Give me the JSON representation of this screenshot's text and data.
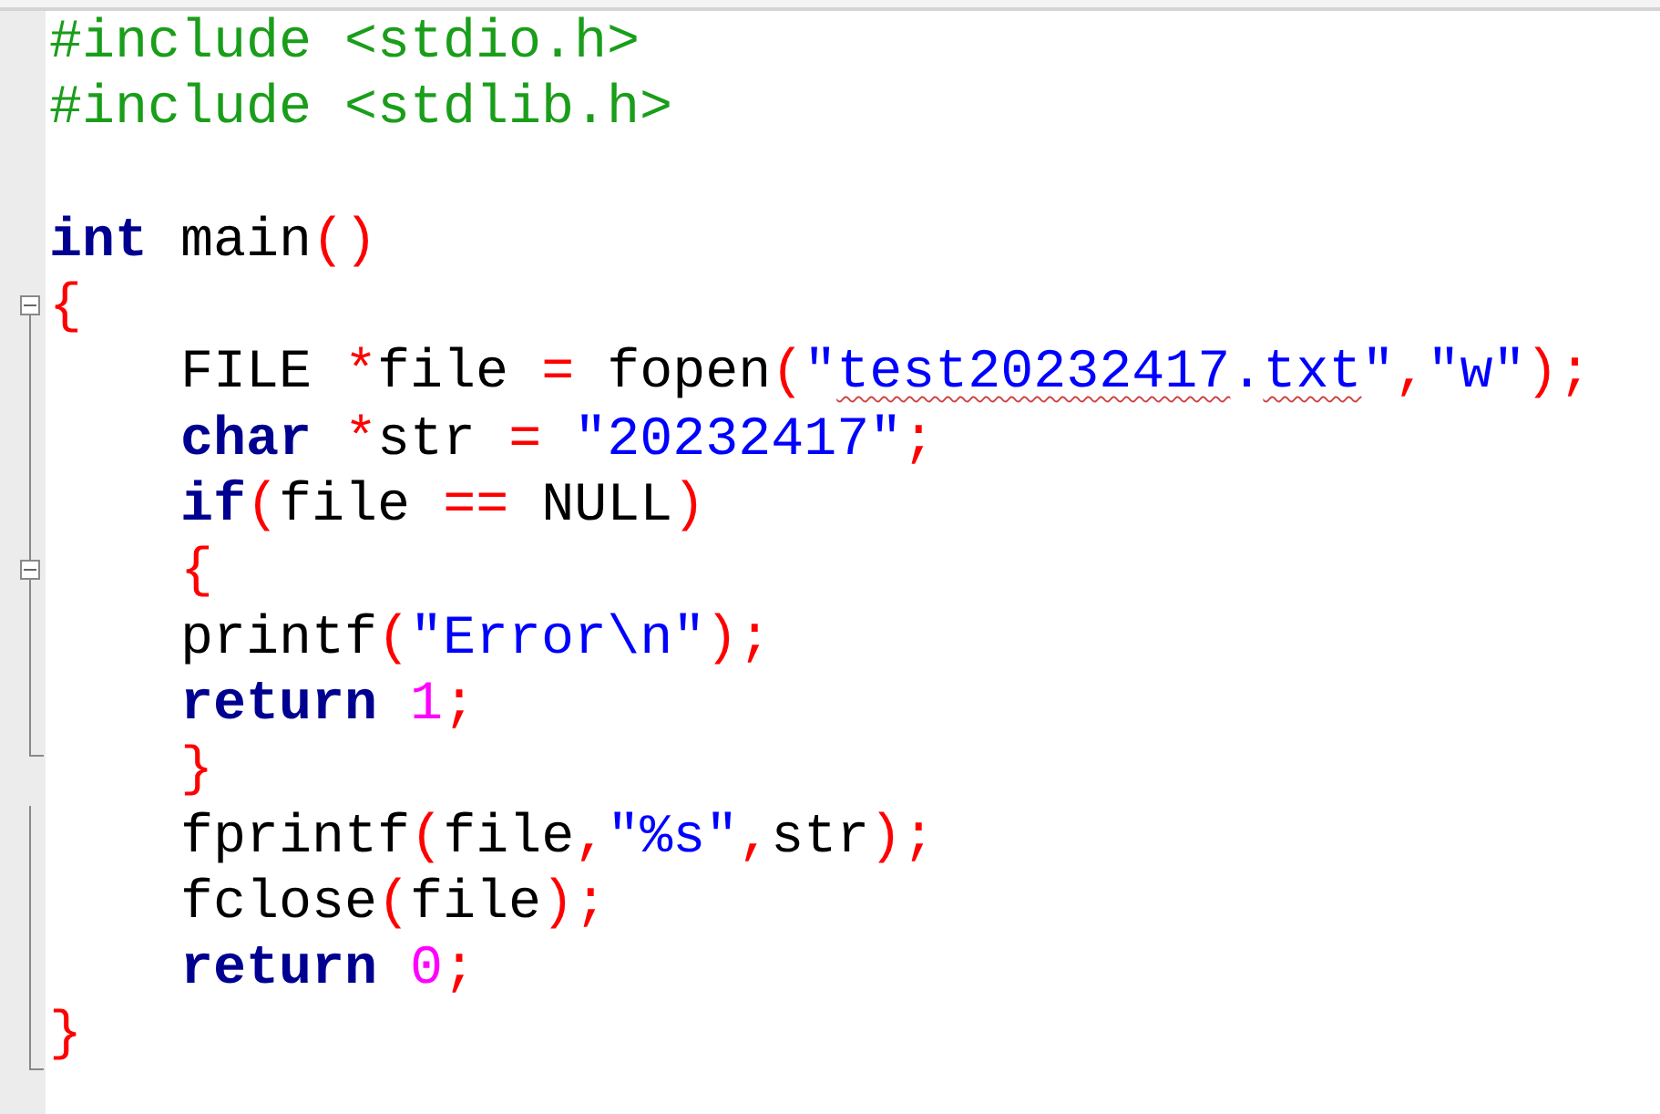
{
  "editor": {
    "lines": [
      {
        "fold_toggle": false,
        "in_fold": false,
        "fold_end": false,
        "tokens": [
          {
            "kind": "preprocessor",
            "text": "#include <stdio.h>"
          }
        ]
      },
      {
        "fold_toggle": false,
        "in_fold": false,
        "fold_end": false,
        "tokens": [
          {
            "kind": "preprocessor",
            "text": "#include <stdlib.h>"
          }
        ]
      },
      {
        "fold_toggle": false,
        "in_fold": false,
        "fold_end": false
      },
      {
        "fold_toggle": false,
        "in_fold": false,
        "fold_end": false,
        "tokens": [
          {
            "kind": "keyword",
            "text": "int"
          },
          {
            "kind": "plain",
            "text": " main"
          },
          {
            "kind": "operator",
            "text": "()"
          }
        ]
      },
      {
        "fold_toggle": true,
        "in_fold": false,
        "fold_end": false,
        "tokens": [
          {
            "kind": "operator",
            "text": "{"
          }
        ]
      },
      {
        "fold_toggle": false,
        "in_fold": true,
        "fold_end": false,
        "tokens": [
          {
            "kind": "plain",
            "text": "    FILE "
          },
          {
            "kind": "operator",
            "text": "*"
          },
          {
            "kind": "plain",
            "text": "file "
          },
          {
            "kind": "operator",
            "text": "="
          },
          {
            "kind": "plain",
            "text": " fopen"
          },
          {
            "kind": "operator",
            "text": "("
          },
          {
            "kind": "string",
            "text": "\""
          },
          {
            "kind": "string",
            "text": "test20232417",
            "misspelled": true
          },
          {
            "kind": "string",
            "text": "."
          },
          {
            "kind": "string",
            "text": "txt",
            "misspelled": true
          },
          {
            "kind": "string",
            "text": "\""
          },
          {
            "kind": "operator",
            "text": ","
          },
          {
            "kind": "string",
            "text": "\"w\""
          },
          {
            "kind": "operator",
            "text": ");"
          }
        ]
      },
      {
        "fold_toggle": false,
        "in_fold": true,
        "fold_end": false,
        "tokens": [
          {
            "kind": "keyword",
            "text": "    char"
          },
          {
            "kind": "operator",
            "text": " *"
          },
          {
            "kind": "plain",
            "text": "str "
          },
          {
            "kind": "operator",
            "text": "="
          },
          {
            "kind": "string",
            "text": " \"20232417\""
          },
          {
            "kind": "operator",
            "text": ";"
          }
        ]
      },
      {
        "fold_toggle": false,
        "in_fold": true,
        "fold_end": false,
        "tokens": [
          {
            "kind": "keyword",
            "text": "    if"
          },
          {
            "kind": "operator",
            "text": "("
          },
          {
            "kind": "plain",
            "text": "file "
          },
          {
            "kind": "operator",
            "text": "=="
          },
          {
            "kind": "plain",
            "text": " NULL"
          },
          {
            "kind": "operator",
            "text": ")"
          }
        ]
      },
      {
        "fold_toggle": true,
        "in_fold": true,
        "fold_end": false,
        "tokens": [
          {
            "kind": "operator",
            "text": "    {"
          }
        ]
      },
      {
        "fold_toggle": false,
        "in_fold": true,
        "fold_end": false,
        "tokens": [
          {
            "kind": "plain",
            "text": "    printf"
          },
          {
            "kind": "operator",
            "text": "("
          },
          {
            "kind": "string",
            "text": "\"Error\\n\""
          },
          {
            "kind": "operator",
            "text": ");"
          }
        ]
      },
      {
        "fold_toggle": false,
        "in_fold": true,
        "fold_end": false,
        "tokens": [
          {
            "kind": "keyword",
            "text": "    return"
          },
          {
            "kind": "number",
            "text": " 1"
          },
          {
            "kind": "operator",
            "text": ";"
          }
        ]
      },
      {
        "fold_toggle": false,
        "in_fold": true,
        "fold_end": true,
        "tokens": [
          {
            "kind": "operator",
            "text": "    }"
          }
        ]
      },
      {
        "fold_toggle": false,
        "in_fold": true,
        "fold_end": false,
        "tokens": [
          {
            "kind": "plain",
            "text": "    fprintf"
          },
          {
            "kind": "operator",
            "text": "("
          },
          {
            "kind": "plain",
            "text": "file"
          },
          {
            "kind": "operator",
            "text": ","
          },
          {
            "kind": "string",
            "text": "\"%s\""
          },
          {
            "kind": "operator",
            "text": ","
          },
          {
            "kind": "plain",
            "text": "str"
          },
          {
            "kind": "operator",
            "text": ");"
          }
        ]
      },
      {
        "fold_toggle": false,
        "in_fold": true,
        "fold_end": false,
        "tokens": [
          {
            "kind": "plain",
            "text": "    fclose"
          },
          {
            "kind": "operator",
            "text": "("
          },
          {
            "kind": "plain",
            "text": "file"
          },
          {
            "kind": "operator",
            "text": ");"
          }
        ]
      },
      {
        "fold_toggle": false,
        "in_fold": true,
        "fold_end": false,
        "tokens": [
          {
            "kind": "keyword",
            "text": "    return"
          },
          {
            "kind": "number",
            "text": " 0"
          },
          {
            "kind": "operator",
            "text": ";"
          }
        ]
      },
      {
        "fold_toggle": false,
        "in_fold": true,
        "fold_end": true,
        "tokens": [
          {
            "kind": "operator",
            "text": "}"
          }
        ]
      }
    ]
  }
}
